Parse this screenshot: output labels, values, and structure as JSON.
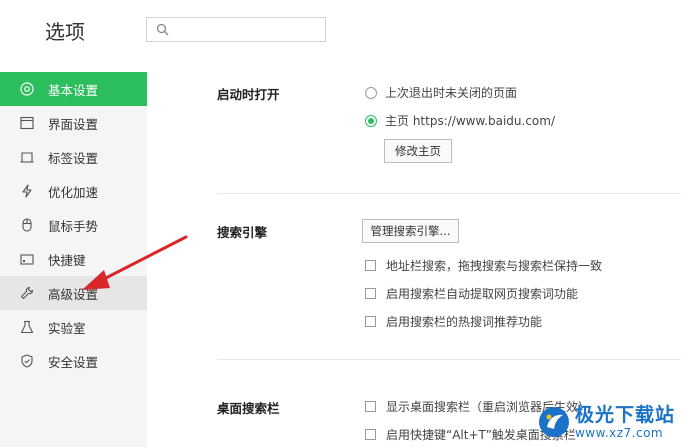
{
  "header": {
    "title": "选项",
    "search_value": "",
    "search_icon": "search-icon"
  },
  "sidebar": {
    "active_color": "#2cbd5d",
    "items": [
      {
        "label": "基本设置",
        "icon": "target-icon",
        "active": true
      },
      {
        "label": "界面设置",
        "icon": "window-icon"
      },
      {
        "label": "标签设置",
        "icon": "tab-icon"
      },
      {
        "label": "优化加速",
        "icon": "lightning-icon"
      },
      {
        "label": "鼠标手势",
        "icon": "mouse-icon"
      },
      {
        "label": "快捷键",
        "icon": "keyboard-icon"
      },
      {
        "label": "高级设置",
        "icon": "wrench-icon",
        "hover": true
      },
      {
        "label": "实验室",
        "icon": "flask-icon"
      },
      {
        "label": "安全设置",
        "icon": "shield-icon"
      }
    ]
  },
  "startup": {
    "title": "启动时打开",
    "option_restore": "上次退出时未关闭的页面",
    "option_home": "主页  https://www.baidu.com/",
    "selected": "option_home",
    "change_home_button": "修改主页"
  },
  "search_engine": {
    "title": "搜索引擎",
    "manage_button": "管理搜索引擎...",
    "options": [
      {
        "label": "地址栏搜索，拖拽搜索与搜索栏保持一致",
        "checked": false
      },
      {
        "label": "启用搜索栏自动提取网页搜索词功能",
        "checked": false
      },
      {
        "label": "启用搜索栏的热搜词推荐功能",
        "checked": false
      }
    ]
  },
  "desktop_search": {
    "title": "桌面搜索栏",
    "options": [
      {
        "label": "显示桌面搜索栏（重启浏览器后生效）",
        "checked": false
      },
      {
        "label": "启用快捷键“Alt+T”触发桌面搜索栏",
        "checked": false
      }
    ]
  },
  "watermark": {
    "title": "极光下载站",
    "url": "www.xz7.com"
  },
  "annotation_color": "#d9262b"
}
